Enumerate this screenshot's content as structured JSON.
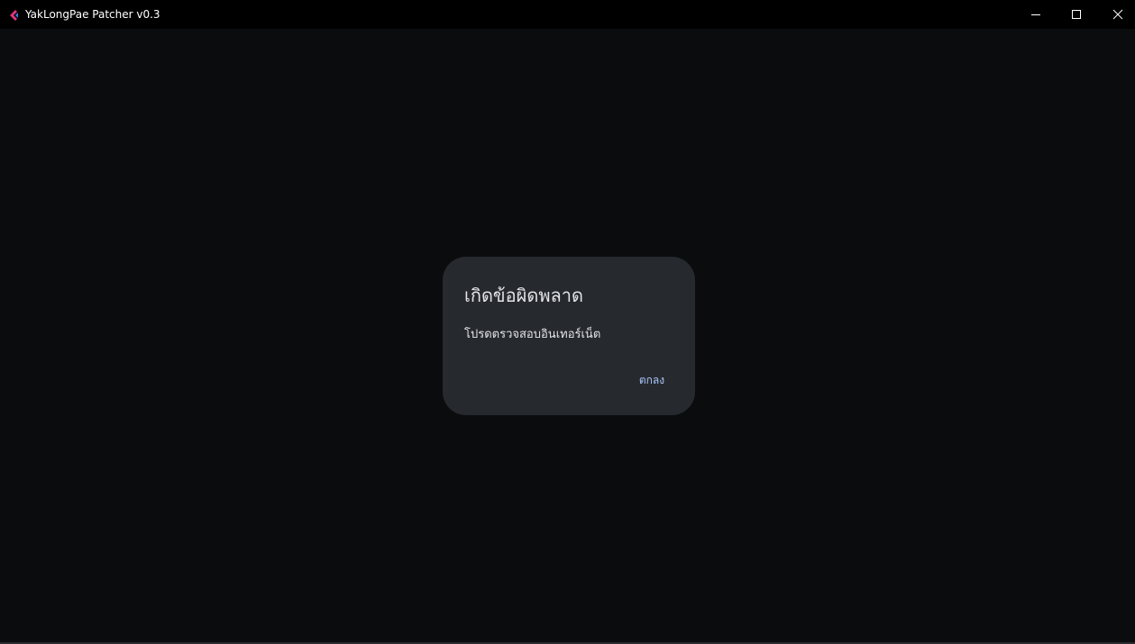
{
  "window": {
    "title": "YakLongPae Patcher v0.3",
    "icon": "app-arrow-icon",
    "controls": {
      "minimize": "minimize-icon",
      "maximize": "maximize-icon",
      "close": "close-icon"
    }
  },
  "dialog": {
    "title": "เกิดข้อผิดพลาด",
    "message": "โปรดตรวจสอบอินเทอร์เน็ต",
    "ok_label": "ตกลง"
  },
  "colors": {
    "background": "#0b0c0e",
    "titlebar": "#000000",
    "dialog_surface": "#26292e",
    "dialog_text": "#e4e4e6",
    "accent": "#a8c7fa"
  }
}
